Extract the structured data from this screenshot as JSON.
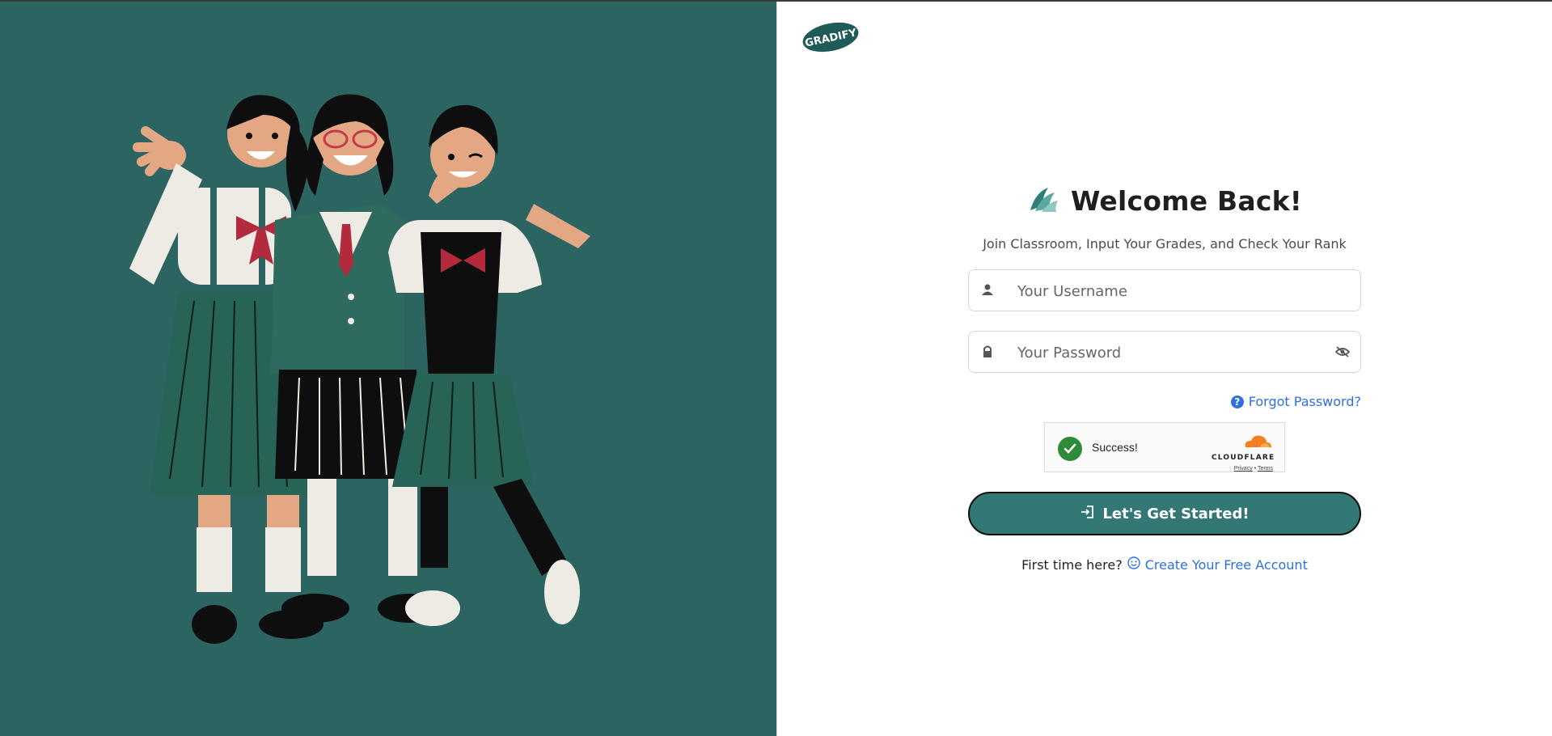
{
  "brand": {
    "logo_text": "GRADIFY"
  },
  "login": {
    "title": "Welcome Back!",
    "subtitle": "Join Classroom, Input Your Grades, and Check Your Rank",
    "username_placeholder": "Your Username",
    "password_placeholder": "Your Password",
    "forgot_label": "Forgot Password?",
    "captcha": {
      "status": "Success!",
      "provider": "CLOUDFLARE",
      "privacy": "Privacy",
      "separator": "•",
      "terms": "Terms"
    },
    "start_label": "Let's Get Started!",
    "first_time_text": "First time here?",
    "create_label": "Create Your Free Account"
  },
  "colors": {
    "panel": "#2c6462",
    "button": "#347876",
    "link": "#2f6fdd",
    "success": "#2e8b3a"
  },
  "icons": [
    "user-icon",
    "lock-icon",
    "eye-slash-icon",
    "question-icon",
    "check-icon",
    "login-icon",
    "smile-icon",
    "brand-mark-icon",
    "cloudflare-cloud-icon"
  ]
}
